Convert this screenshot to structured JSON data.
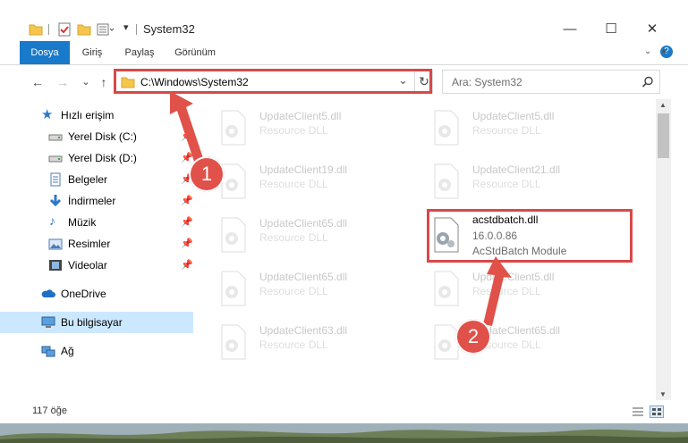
{
  "window": {
    "title": "System32",
    "minimize_symbol": "—",
    "maximize_symbol": "☐",
    "close_symbol": "✕"
  },
  "ribbon": {
    "tabs": [
      "Dosya",
      "Giriş",
      "Paylaş",
      "Görünüm"
    ],
    "help_symbol": "?"
  },
  "navigation": {
    "back": "←",
    "forward": "→",
    "recent": "⌄",
    "up": "↑",
    "address": "C:\\Windows\\System32",
    "refresh": "↻",
    "dropdown": "⌄",
    "search_placeholder": "Ara: System32"
  },
  "sidebar": {
    "quick_access": "Hızlı erişim",
    "items": [
      {
        "label": "Yerel Disk (C:)",
        "icon": "drive-icon"
      },
      {
        "label": "Yerel Disk (D:)",
        "icon": "drive-icon"
      },
      {
        "label": "Belgeler",
        "icon": "documents-icon"
      },
      {
        "label": "İndirmeler",
        "icon": "downloads-icon"
      },
      {
        "label": "Müzik",
        "icon": "music-icon"
      },
      {
        "label": "Resimler",
        "icon": "pictures-icon"
      },
      {
        "label": "Videolar",
        "icon": "videos-icon"
      }
    ],
    "onedrive": "OneDrive",
    "this_pc": "Bu bilgisayar",
    "network": "Ağ"
  },
  "files": [
    {
      "name": "UpdateClient5.dll",
      "type": "Resource DLL",
      "ghost": true
    },
    {
      "name": "UpdateClient5.dll",
      "type": "Resource DLL",
      "ghost": true
    },
    {
      "name": "UpdateClient19.dll",
      "type": "Resource DLL",
      "ghost": true
    },
    {
      "name": "UpdateClient21.dll",
      "type": "Resource DLL",
      "ghost": true
    },
    {
      "name": "UpdateClient65.dll",
      "type": "Resource DLL",
      "ghost": true
    },
    {
      "name": "acstdbatch.dll",
      "version": "16.0.0.86",
      "description": "AcStdBatch Module",
      "ghost": false
    },
    {
      "name": "UpdateClient65.dll",
      "type": "Resource DLL",
      "ghost": true
    },
    {
      "name": "UpdateClient5.dll",
      "type": "Resource DLL",
      "ghost": true
    },
    {
      "name": "UpdateClient63.dll",
      "type": "Resource DLL",
      "ghost": true
    },
    {
      "name": "UpdateClient65.dll",
      "type": "Resource DLL",
      "ghost": true
    }
  ],
  "status": {
    "item_count": "117 öğe"
  },
  "annotations": {
    "step1": "1",
    "step2": "2",
    "color": "#d94848"
  }
}
